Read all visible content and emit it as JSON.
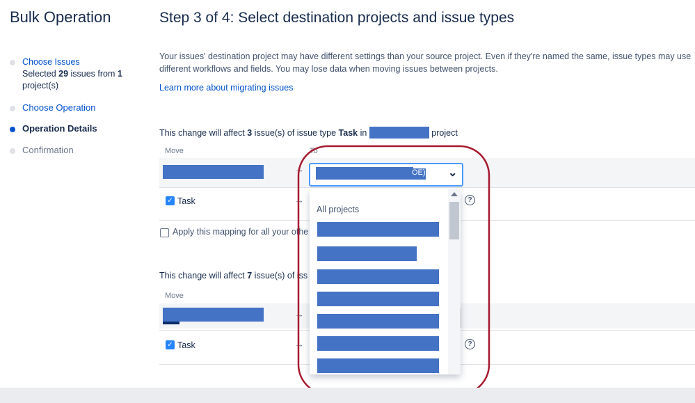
{
  "sidebar": {
    "title": "Bulk Operation",
    "steps": [
      {
        "label": "Choose Issues",
        "detail_pre": "Selected ",
        "detail_count": "29",
        "detail_mid": " issues from ",
        "detail_projects": "1",
        "detail_post": " project(s)"
      },
      {
        "label": "Choose Operation"
      },
      {
        "label": "Operation Details"
      },
      {
        "label": "Confirmation"
      }
    ]
  },
  "main": {
    "title": "Step 3 of 4: Select destination projects and issue types",
    "intro": "Your issues' destination project may have different settings than your source project. Even if they're named the same, issue types may use different workflows and fields. You may lose data when moving issues between projects.",
    "learn_more": "Learn more about migrating issues",
    "group1": {
      "affect_pre": "This change will affect ",
      "count": "3",
      "affect_mid": " issue(s) of issue type ",
      "issue_type": "Task",
      "affect_in": " in ",
      "affect_post": " project",
      "col_move": "Move",
      "col_to": "To",
      "select_suffix": "OE)",
      "task_label": "Task",
      "apply_label": "Apply this mapping for all your othe"
    },
    "group2": {
      "affect_pre": "This change will affect ",
      "count": "7",
      "affect_mid": " issue(s) of iss",
      "col_move": "Move",
      "task_label": "Task"
    },
    "dropdown": {
      "header": "All projects"
    },
    "icons": {
      "arrow": "→",
      "chevron": "⌄",
      "check": "✓",
      "help": "?"
    }
  },
  "colors": {
    "accent": "#0052cc",
    "redaction": "#4472c4",
    "annotation": "#a6192e"
  }
}
